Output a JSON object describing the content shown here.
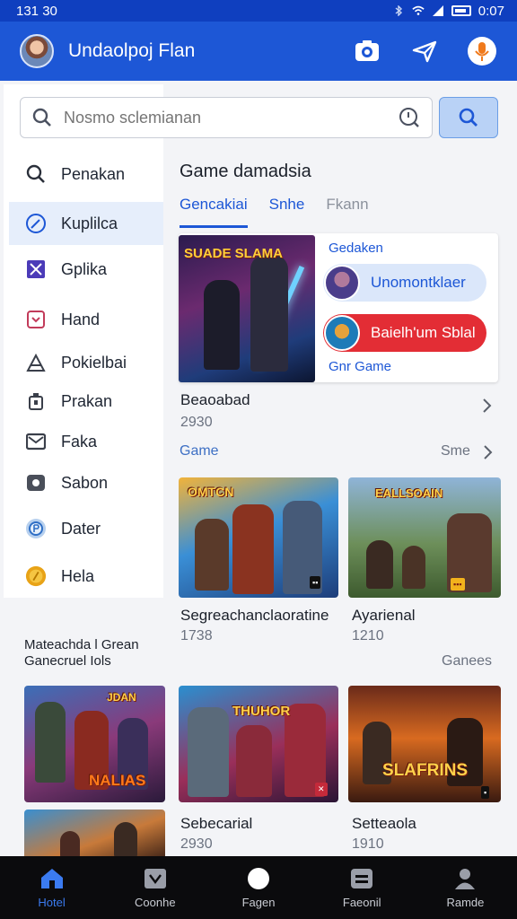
{
  "status": {
    "time": "131 30",
    "right_time": "0:07"
  },
  "header": {
    "title": "Undaolpoj Flan",
    "icons": [
      "camera-icon",
      "send-icon",
      "mic-icon"
    ]
  },
  "search": {
    "placeholder": "Nosmo sclemianan"
  },
  "sidebar": {
    "items": [
      {
        "label": "Penakan",
        "icon": "search-icon"
      },
      {
        "label": "Kuplilca",
        "icon": "compass-icon",
        "active": true
      },
      {
        "label": "Gplika",
        "icon": "bookmark-icon"
      },
      {
        "label": "Hand",
        "icon": "download-icon"
      },
      {
        "label": "Pokielbai",
        "icon": "tent-icon"
      },
      {
        "label": "Prakan",
        "icon": "trash-icon"
      },
      {
        "label": "Faka",
        "icon": "mail-icon"
      },
      {
        "label": "Sabon",
        "icon": "camera-box-icon"
      },
      {
        "label": "Dater",
        "icon": "globe-icon"
      },
      {
        "label": "Hela",
        "icon": "coin-icon"
      }
    ]
  },
  "main": {
    "section_title": "Game damadsia",
    "tabs": [
      {
        "label": "Gencakiai",
        "active": true
      },
      {
        "label": "Snhe"
      },
      {
        "label": "Fkann"
      }
    ],
    "featured": {
      "art_title": "SUADE SLAMA",
      "label": "Gedaken",
      "pill1": "Unomontklaer",
      "pill2": "Baielh'um Sblal",
      "footer": "Gnr Game",
      "name": "Beaoabad",
      "sub": "2930"
    },
    "row1": {
      "label_left": "Game",
      "label_right": "Sme",
      "items": [
        {
          "name": "Segreachanclaoratine",
          "sub": "1738",
          "art_title": "OMTCN"
        },
        {
          "name": "Ayarienal",
          "sub": "1210",
          "art_title": "EALLSOAIN"
        }
      ]
    },
    "categories": {
      "line1": "Mateachda l Grean",
      "line2": "Ganecruel Iols",
      "right": "Ganees"
    },
    "row2": {
      "items": [
        {
          "art_title": "NALIAS",
          "top_title": "JDAN"
        },
        {
          "art_title": "THUHOR",
          "name": "Sebecarial",
          "sub": "2930"
        },
        {
          "art_title": "SLAFRINS",
          "name": "Setteaola",
          "sub": "1910"
        }
      ]
    }
  },
  "bottomnav": {
    "items": [
      {
        "label": "Hotel",
        "icon": "home-icon",
        "active": true
      },
      {
        "label": "Coonhe",
        "icon": "games-icon"
      },
      {
        "label": "Fagen",
        "icon": "circle-icon"
      },
      {
        "label": "Faeonil",
        "icon": "list-icon"
      },
      {
        "label": "Ramde",
        "icon": "profile-icon"
      }
    ]
  }
}
